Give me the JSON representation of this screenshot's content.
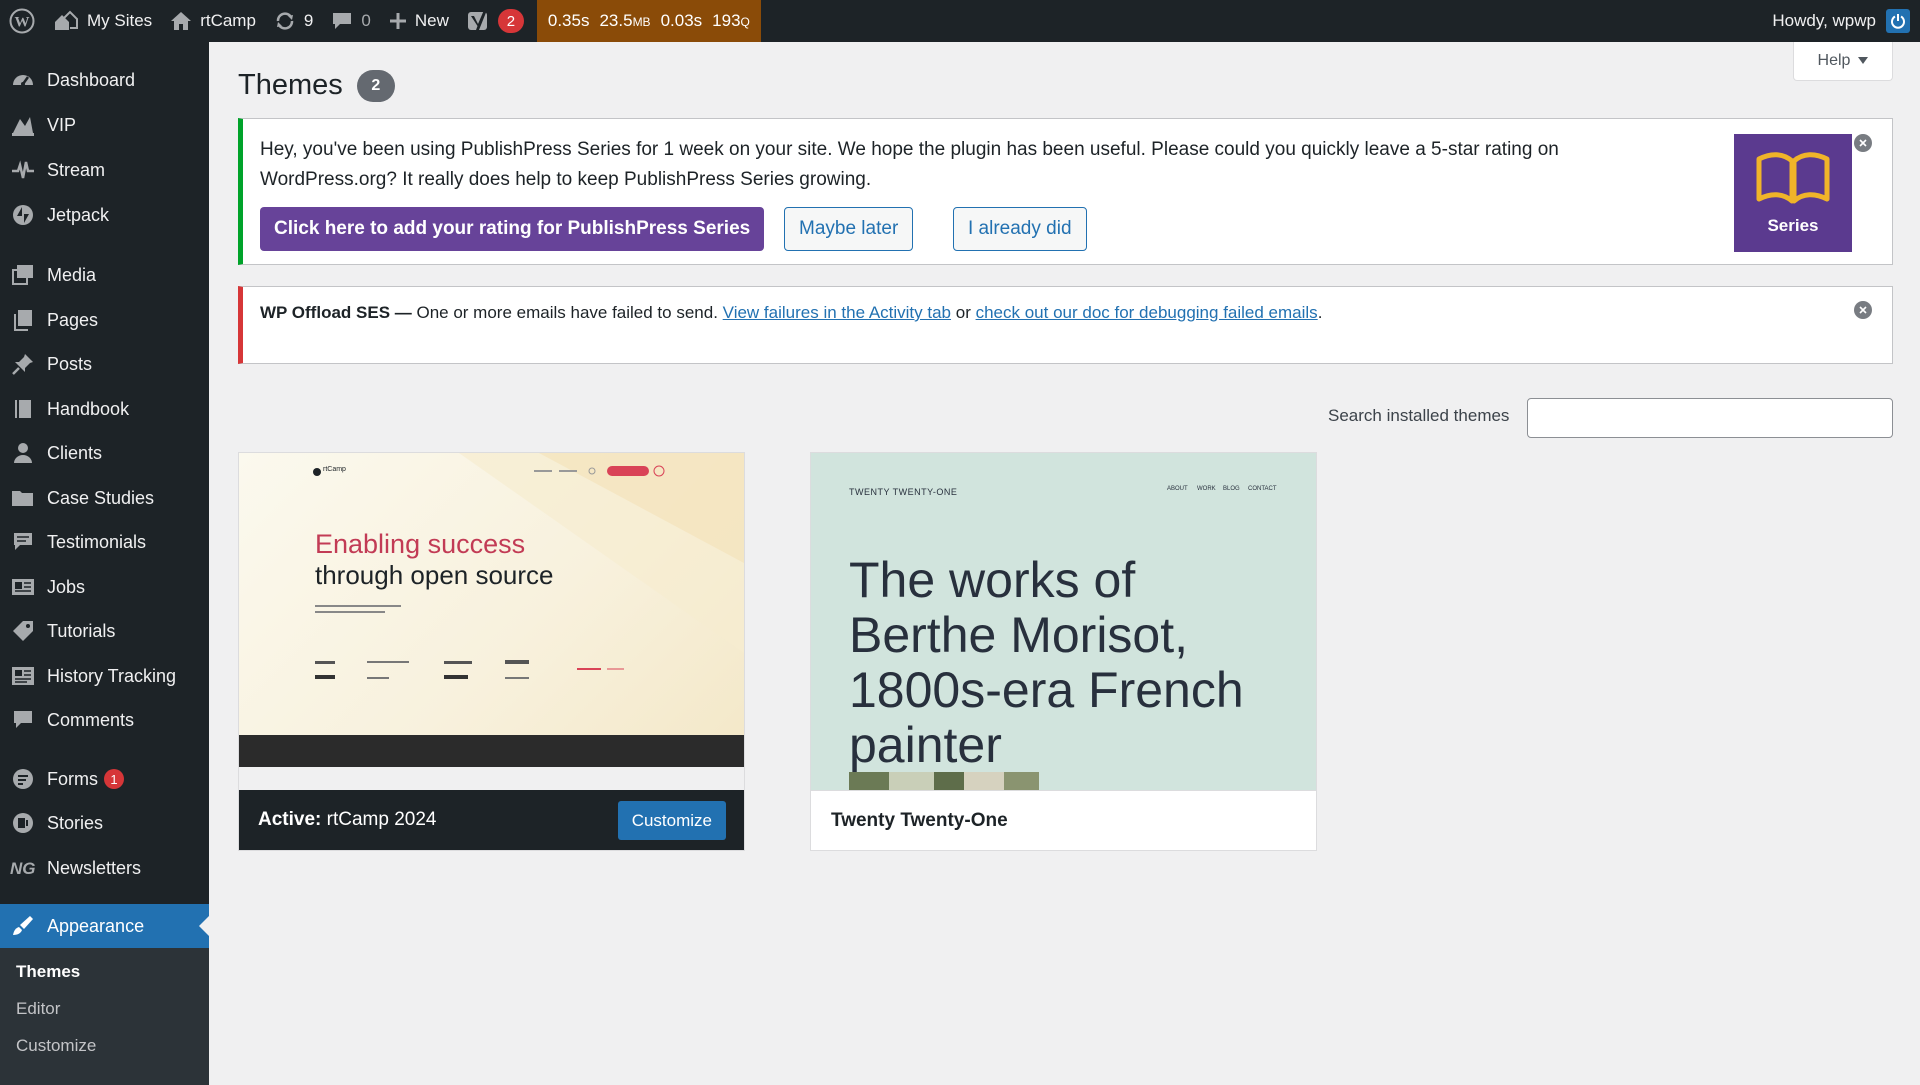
{
  "adminbar": {
    "my_sites": "My Sites",
    "site_name": "rtCamp",
    "updates_count": "9",
    "comments_count": "0",
    "new_label": "New",
    "yoast_count": "2",
    "perf": {
      "time1": "0.35s",
      "memory": "23.5",
      "memory_unit": "MB",
      "time2": "0.03s",
      "queries": "193",
      "queries_unit": "Q"
    },
    "howdy": "Howdy, wpwp"
  },
  "sidebar": {
    "items": [
      {
        "label": "Dashboard",
        "icon": "dashboard-icon"
      },
      {
        "label": "VIP",
        "icon": "vip-icon"
      },
      {
        "label": "Stream",
        "icon": "stream-icon"
      },
      {
        "label": "Jetpack",
        "icon": "jetpack-icon"
      },
      {
        "label": "Media",
        "icon": "media-icon"
      },
      {
        "label": "Pages",
        "icon": "pages-icon"
      },
      {
        "label": "Posts",
        "icon": "pin-icon"
      },
      {
        "label": "Handbook",
        "icon": "book-icon"
      },
      {
        "label": "Clients",
        "icon": "user-icon"
      },
      {
        "label": "Case Studies",
        "icon": "folder-icon"
      },
      {
        "label": "Testimonials",
        "icon": "testimonial-icon"
      },
      {
        "label": "Jobs",
        "icon": "id-card-icon"
      },
      {
        "label": "Tutorials",
        "icon": "tag-icon"
      },
      {
        "label": "History Tracking",
        "icon": "history-icon"
      },
      {
        "label": "Comments",
        "icon": "comment-icon"
      },
      {
        "label": "Forms",
        "icon": "forms-icon",
        "badge": "1"
      },
      {
        "label": "Stories",
        "icon": "stories-icon"
      },
      {
        "label": "Newsletters",
        "icon": "ng-icon"
      },
      {
        "label": "Appearance",
        "icon": "brush-icon"
      }
    ],
    "submenu": [
      "Themes",
      "Editor",
      "Customize"
    ]
  },
  "help_label": "Help",
  "page": {
    "title": "Themes",
    "count": "2"
  },
  "notice_publishpress": {
    "text": "Hey, you've been using PublishPress Series for 1 week on your site. We hope the plugin has been useful. Please could you quickly leave a 5-star rating on WordPress.org? It really does help to keep PublishPress Series growing.",
    "primary_button": "Click here to add your rating for PublishPress Series",
    "maybe_later": "Maybe later",
    "already_did": "I already did",
    "logo_label": "Series"
  },
  "notice_ses": {
    "title": "WP Offload SES —",
    "text": " One or more emails have failed to send. ",
    "link1": "View failures in the Activity tab",
    "or": " or ",
    "link2": "check out our doc for debugging failed emails",
    "end": "."
  },
  "search": {
    "label": "Search installed themes",
    "placeholder": ""
  },
  "themes": [
    {
      "prefix": "Active:",
      "name": "rtCamp 2024",
      "action": "Customize",
      "preview": {
        "logo": "rtCamp",
        "headline_1": "Enabling success",
        "headline_2": "through open source"
      }
    },
    {
      "name": "Twenty Twenty-One",
      "preview": {
        "site_title": "TWENTY TWENTY-ONE",
        "nav": [
          "ABOUT",
          "WORK",
          "BLOG",
          "CONTACT"
        ],
        "headline": "The works of Berthe Morisot, 1800s-era French painter"
      }
    }
  ]
}
